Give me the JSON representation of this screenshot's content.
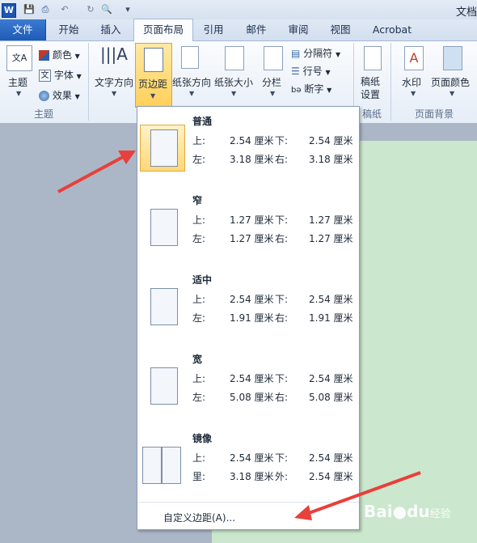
{
  "window": {
    "title": "文档"
  },
  "quick_access": {
    "app_icon": "W"
  },
  "tabs": [
    "文件",
    "开始",
    "插入",
    "页面布局",
    "引用",
    "邮件",
    "审阅",
    "视图",
    "Acrobat"
  ],
  "ribbon": {
    "themes": {
      "theme_label": "主题",
      "colors_label": "颜色",
      "fonts_label": "字体",
      "effects_label": "效果",
      "group_label": "主题"
    },
    "page_setup": {
      "text_direction": "文字方向",
      "margins": "页边距",
      "orientation": "纸张方向",
      "size": "纸张大小",
      "columns": "分栏",
      "breaks": "分隔符",
      "line_numbers": "行号",
      "hyphenation": "断字"
    },
    "manuscript": {
      "setup": "稿纸\n设置",
      "setup_l1": "稿纸",
      "setup_l2": "设置",
      "group_label": "稿纸"
    },
    "page_background": {
      "watermark": "水印",
      "page_color": "页面颜色",
      "group_label": "页面背景"
    }
  },
  "margins_menu": {
    "options": [
      {
        "name": "普通",
        "r1": [
          "上:",
          "2.54 厘米",
          "下:",
          "2.54 厘米"
        ],
        "r2": [
          "左:",
          "3.18 厘米",
          "右:",
          "3.18 厘米"
        ]
      },
      {
        "name": "窄",
        "r1": [
          "上:",
          "1.27 厘米",
          "下:",
          "1.27 厘米"
        ],
        "r2": [
          "左:",
          "1.27 厘米",
          "右:",
          "1.27 厘米"
        ]
      },
      {
        "name": "适中",
        "r1": [
          "上:",
          "2.54 厘米",
          "下:",
          "2.54 厘米"
        ],
        "r2": [
          "左:",
          "1.91 厘米",
          "右:",
          "1.91 厘米"
        ]
      },
      {
        "name": "宽",
        "r1": [
          "上:",
          "2.54 厘米",
          "下:",
          "2.54 厘米"
        ],
        "r2": [
          "左:",
          "5.08 厘米",
          "右:",
          "5.08 厘米"
        ]
      },
      {
        "name": "镜像",
        "r1": [
          "上:",
          "2.54 厘米",
          "下:",
          "2.54 厘米"
        ],
        "r2": [
          "里:",
          "3.18 厘米",
          "外:",
          "2.54 厘米"
        ]
      }
    ],
    "custom": "自定义边距(A)..."
  },
  "watermark_text": {
    "brand": "Bai",
    "paw": "du",
    "tail": "经验"
  },
  "colors": {
    "arrow": "#e8403a",
    "accent": "#1d5bb8",
    "page": "#cbe7cd"
  }
}
